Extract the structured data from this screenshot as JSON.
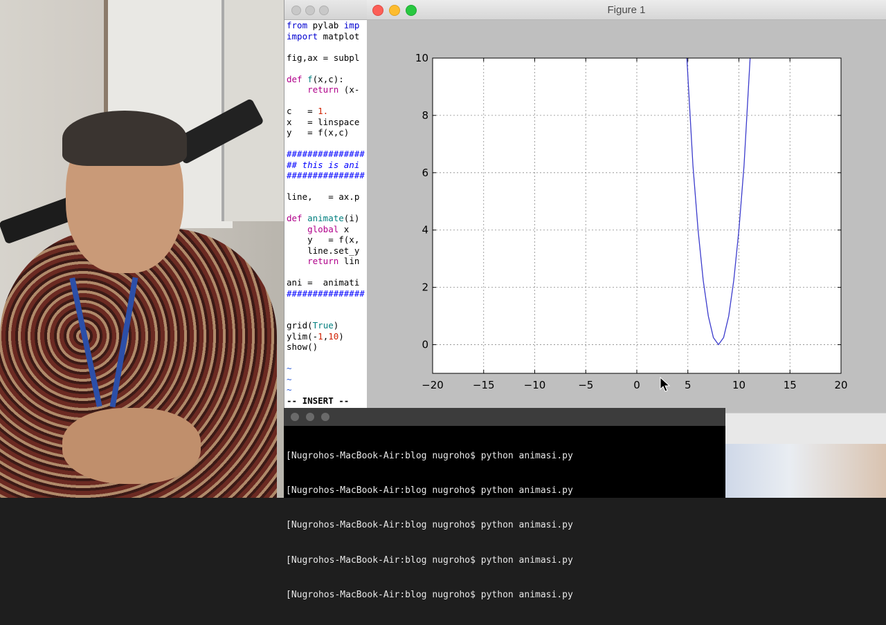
{
  "figure": {
    "title": "Figure 1",
    "toolbar": [
      "home-icon",
      "back-icon",
      "forward-icon",
      "pan-icon",
      "edit-icon",
      "configure-icon",
      "save-icon"
    ]
  },
  "chart_data": {
    "type": "line",
    "title": "",
    "xlabel": "",
    "ylabel": "",
    "xlim": [
      -20,
      20
    ],
    "ylim": [
      -1,
      10
    ],
    "grid": true,
    "x_ticks": [
      "−20",
      "−15",
      "−10",
      "−5",
      "0",
      "5",
      "10",
      "15",
      "20"
    ],
    "y_ticks": [
      "0",
      "2",
      "4",
      "6",
      "8",
      "10"
    ],
    "series": [
      {
        "color": "#3b3bcc",
        "x": [
          4.9,
          5.5,
          6.0,
          6.5,
          7.0,
          7.5,
          8.0,
          8.5,
          9.0,
          9.5,
          10.0,
          10.5,
          11.1
        ],
        "y": [
          10.0,
          6.25,
          4.0,
          2.25,
          1.0,
          0.25,
          0.0,
          0.25,
          1.0,
          2.25,
          4.0,
          6.25,
          10.0
        ]
      }
    ]
  },
  "editor": {
    "mode": "-- INSERT --"
  },
  "terminal": {
    "lines": [
      "[Nugrohos-MacBook-Air:blog nugroho$ python animasi.py",
      "[Nugrohos-MacBook-Air:blog nugroho$ python animasi.py",
      "[Nugrohos-MacBook-Air:blog nugroho$ python animasi.py",
      "[Nugrohos-MacBook-Air:blog nugroho$ python animasi.py",
      "[Nugrohos-MacBook-Air:blog nugroho$ python animasi.py"
    ]
  }
}
